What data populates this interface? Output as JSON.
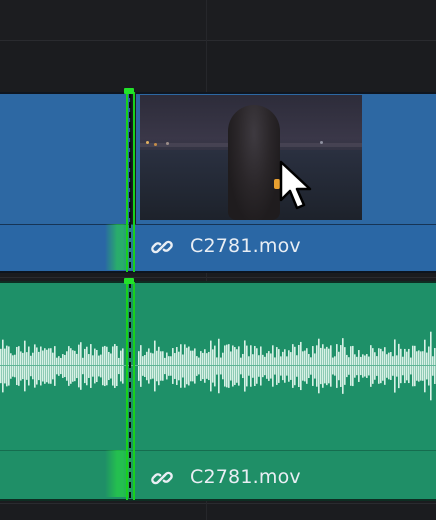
{
  "timeline": {
    "video_clip": {
      "name": "C2781.mov"
    },
    "audio_clip": {
      "name": "C2781.mov"
    }
  },
  "colors": {
    "video_clip": "#2d68a3",
    "audio_clip": "#1e9068",
    "cut_marker": "#18d21a",
    "background": "#1b1c1f"
  },
  "icons": {
    "video_link": "link-icon",
    "audio_link": "link-icon",
    "pointer": "arrow-cursor-icon"
  }
}
